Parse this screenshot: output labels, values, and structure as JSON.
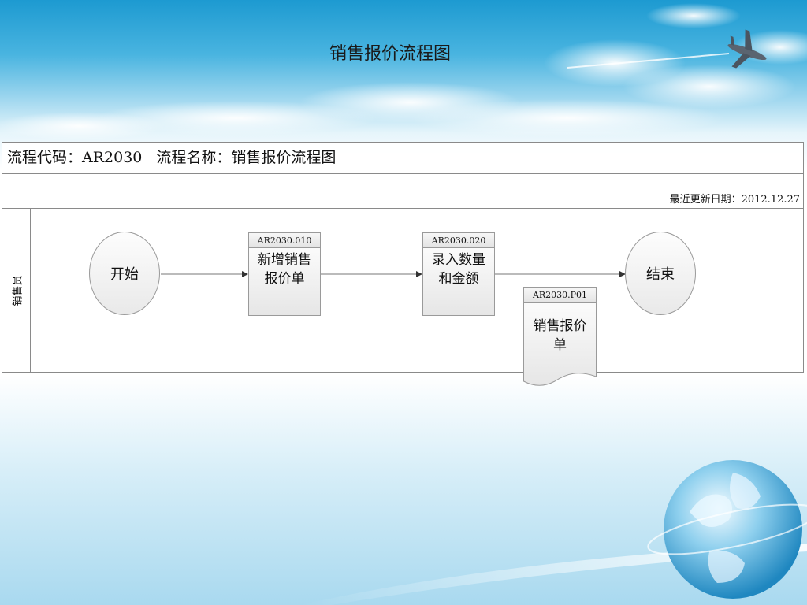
{
  "title": "销售报价流程图",
  "header": {
    "code_label": "流程代码：AR2030",
    "name_label": "流程名称：销售报价流程图"
  },
  "updated": "最近更新日期：2012.12.27",
  "lane": {
    "label": "销售员"
  },
  "nodes": {
    "start": {
      "label": "开始"
    },
    "step1": {
      "code": "AR2030.010",
      "line1": "新增销售",
      "line2": "报价单"
    },
    "step2": {
      "code": "AR2030.020",
      "line1": "录入数量",
      "line2": "和金额"
    },
    "document": {
      "code": "AR2030.P01",
      "line1": "销售报价",
      "line2": "单"
    },
    "end": {
      "label": "结束"
    }
  },
  "icons": {
    "airplane": "airplane-icon",
    "globe": "globe-icon"
  },
  "colors": {
    "sky_top": "#1d9ad1",
    "shape_fill": "#eeeeee",
    "border": "#8a8a8a"
  }
}
